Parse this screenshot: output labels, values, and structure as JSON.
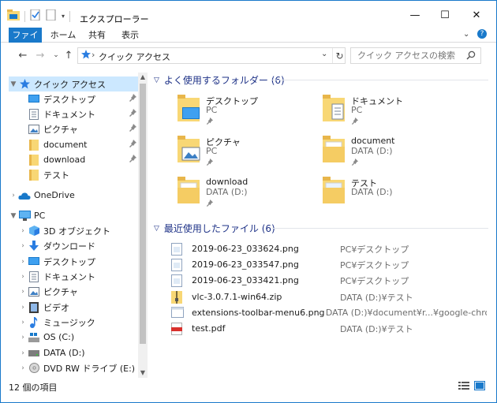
{
  "window": {
    "title": "エクスプローラー",
    "controls": {
      "minimize": "—",
      "maximize": "☐",
      "close": "✕"
    }
  },
  "ribbon": {
    "tabs": [
      {
        "label": "ファイル",
        "active": true
      },
      {
        "label": "ホーム"
      },
      {
        "label": "共有"
      },
      {
        "label": "表示"
      }
    ]
  },
  "address": {
    "breadcrumb": "クイック アクセス",
    "search_placeholder": "クイック アクセスの検索"
  },
  "nav": {
    "quick_access": {
      "label": "クイック アクセス",
      "items": [
        {
          "label": "デスクトップ",
          "icon": "desktop-icon",
          "pinned": true
        },
        {
          "label": "ドキュメント",
          "icon": "documents-icon",
          "pinned": true
        },
        {
          "label": "ピクチャ",
          "icon": "pictures-icon",
          "pinned": true
        },
        {
          "label": "document",
          "icon": "folder-icon",
          "pinned": true
        },
        {
          "label": "download",
          "icon": "folder-icon",
          "pinned": true
        },
        {
          "label": "テスト",
          "icon": "folder-icon",
          "pinned": false
        }
      ]
    },
    "onedrive": {
      "label": "OneDrive"
    },
    "pc": {
      "label": "PC",
      "items": [
        {
          "label": "3D オブジェクト",
          "icon": "3d-objects-icon"
        },
        {
          "label": "ダウンロード",
          "icon": "downloads-icon"
        },
        {
          "label": "デスクトップ",
          "icon": "desktop-icon"
        },
        {
          "label": "ドキュメント",
          "icon": "documents-icon"
        },
        {
          "label": "ピクチャ",
          "icon": "pictures-icon"
        },
        {
          "label": "ビデオ",
          "icon": "videos-icon"
        },
        {
          "label": "ミュージック",
          "icon": "music-icon"
        },
        {
          "label": "OS (C:)",
          "icon": "drive-icon"
        },
        {
          "label": "DATA (D:)",
          "icon": "drive-icon"
        },
        {
          "label": "DVD RW ドライブ (E:)",
          "icon": "dvd-drive-icon"
        }
      ]
    }
  },
  "content": {
    "frequent_header": "よく使用するフォルダー (6)",
    "frequent": [
      {
        "name": "デスクトップ",
        "sub": "PC",
        "icon": "desktop-folder-icon"
      },
      {
        "name": "ドキュメント",
        "sub": "PC",
        "icon": "documents-folder-icon"
      },
      {
        "name": "ピクチャ",
        "sub": "PC",
        "icon": "pictures-folder-icon"
      },
      {
        "name": "document",
        "sub": "DATA (D:)",
        "icon": "folder-icon"
      },
      {
        "name": "download",
        "sub": "DATA (D:)",
        "icon": "folder-icon"
      },
      {
        "name": "テスト",
        "sub": "DATA (D:)",
        "icon": "folder-icon"
      }
    ],
    "recent_header": "最近使用したファイル (6)",
    "recent": [
      {
        "name": "2019-06-23_033624.png",
        "location": "PC¥デスクトップ",
        "icon": "png-file-icon"
      },
      {
        "name": "2019-06-23_033547.png",
        "location": "PC¥デスクトップ",
        "icon": "png-file-icon"
      },
      {
        "name": "2019-06-23_033421.png",
        "location": "PC¥デスクトップ",
        "icon": "png-file-icon"
      },
      {
        "name": "vlc-3.0.7.1-win64.zip",
        "location": "DATA (D:)¥テスト",
        "icon": "zip-file-icon"
      },
      {
        "name": "extensions-toolbar-menu6.png",
        "location": "DATA (D:)¥document¥r...¥google-chrome",
        "icon": "png-file-icon"
      },
      {
        "name": "test.pdf",
        "location": "DATA (D:)¥テスト",
        "icon": "pdf-file-icon"
      }
    ]
  },
  "status": {
    "count": "12 個の項目"
  },
  "colors": {
    "accent": "#1979ca",
    "selection": "#cce8ff",
    "group_header": "#1e3287",
    "folder": "#f8d775"
  }
}
